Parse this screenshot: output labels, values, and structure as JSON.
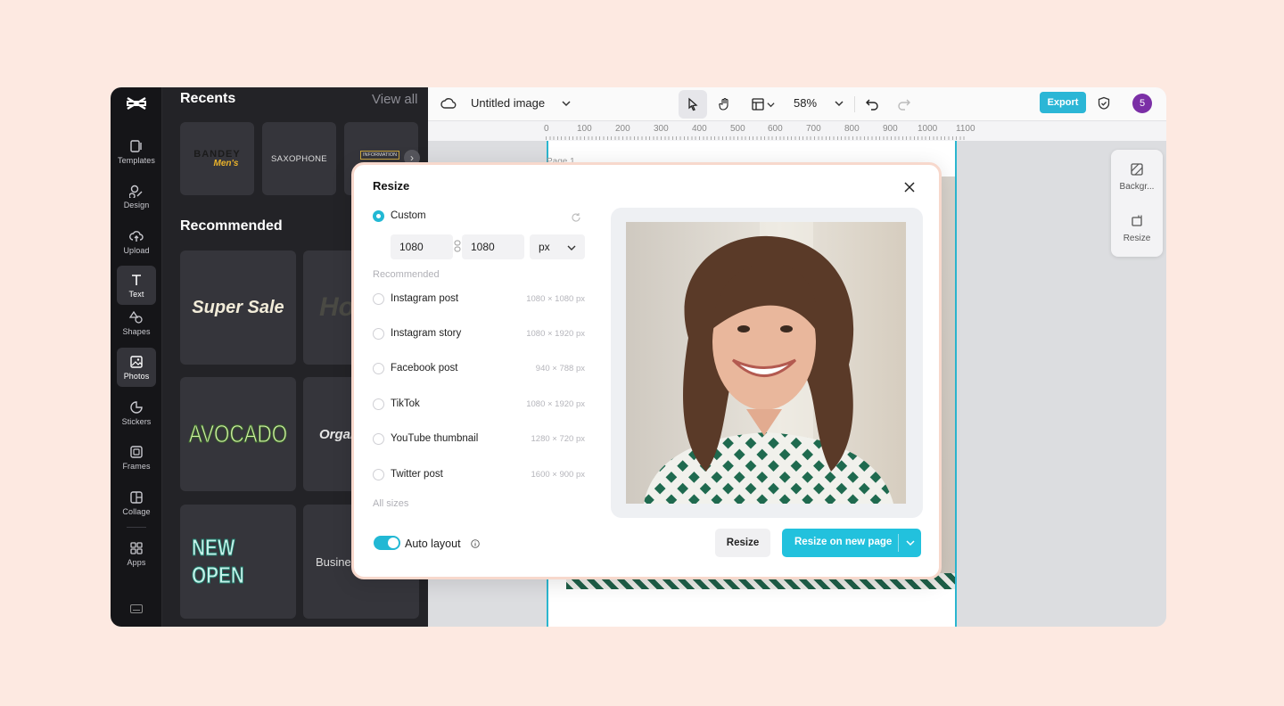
{
  "topbar": {
    "doc_title": "Untitled image",
    "zoom": "58%",
    "export_label": "Export",
    "avatar_initial": "5"
  },
  "rail": {
    "items": [
      {
        "label": "Templates",
        "icon": "template-icon"
      },
      {
        "label": "Design",
        "icon": "design-icon"
      },
      {
        "label": "Upload",
        "icon": "upload-icon"
      },
      {
        "label": "Text",
        "icon": "text-icon"
      },
      {
        "label": "Shapes",
        "icon": "shapes-icon"
      },
      {
        "label": "Photos",
        "icon": "photos-icon"
      },
      {
        "label": "Stickers",
        "icon": "stickers-icon"
      },
      {
        "label": "Frames",
        "icon": "frames-icon"
      },
      {
        "label": "Collage",
        "icon": "collage-icon"
      },
      {
        "label": "Apps",
        "icon": "apps-icon"
      }
    ]
  },
  "panel": {
    "recents_title": "Recents",
    "view_all": "View all",
    "recent_tiles": [
      {
        "line1": "BANDEY",
        "line2": "Men's"
      },
      {
        "line1": "SAXOPHONE",
        "line2": ""
      },
      {
        "line1": "INFORMATION",
        "line2": ""
      }
    ],
    "recommended_title": "Recommended",
    "recommended_tiles": [
      "Super Sale",
      "Ho",
      "AVOCADO",
      "Organ",
      "NEW OPEN",
      "Busine"
    ]
  },
  "ruler": {
    "ticks": [
      "0",
      "100",
      "200",
      "300",
      "400",
      "500",
      "600",
      "700",
      "800",
      "900",
      "1000",
      "1100"
    ]
  },
  "canvas": {
    "page_label": "Page 1"
  },
  "side_tools": [
    {
      "label": "Backgr...",
      "icon": "background-icon"
    },
    {
      "label": "Resize",
      "icon": "resize-icon"
    }
  ],
  "modal": {
    "title": "Resize",
    "custom_label": "Custom",
    "width_value": "1080",
    "height_value": "1080",
    "unit": "px",
    "recommended_label": "Recommended",
    "options": [
      {
        "label": "Instagram post",
        "dims": "1080 × 1080 px"
      },
      {
        "label": "Instagram story",
        "dims": "1080 × 1920 px"
      },
      {
        "label": "Facebook post",
        "dims": "940 × 788 px"
      },
      {
        "label": "TikTok",
        "dims": "1080 × 1920 px"
      },
      {
        "label": "YouTube thumbnail",
        "dims": "1280 × 720 px"
      },
      {
        "label": "Twitter post",
        "dims": "1600 × 900 px"
      }
    ],
    "all_sizes": "All sizes",
    "auto_layout_label": "Auto layout",
    "auto_layout_on": true,
    "resize_button": "Resize",
    "resize_new_page_button": "Resize on new page"
  },
  "colors": {
    "accent": "#22c1dd",
    "background": "#fde9e1",
    "rail": "#151518",
    "panel": "#232327"
  }
}
